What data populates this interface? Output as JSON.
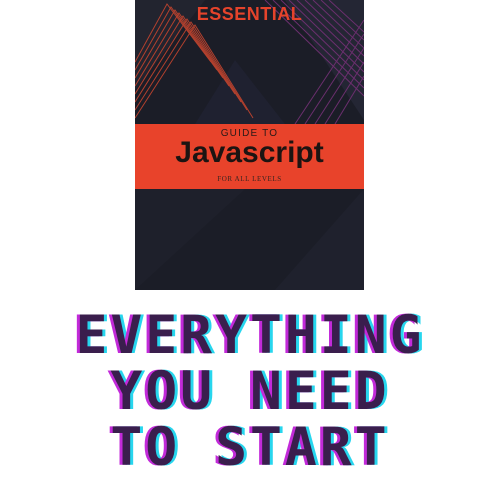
{
  "book_cover": {
    "title": "ESSENTIAL",
    "band_small": "GUIDE TO",
    "band_main": "Javascript",
    "band_footer": "FOR ALL LEVELS",
    "colors": {
      "background": "#1b1d27",
      "accent_red": "#e8432b",
      "line_orange": "#b4412e",
      "line_purple": "#6b2f6e"
    }
  },
  "tagline": {
    "lines": [
      "EVERYTHING",
      "YOU NEED",
      "TO START"
    ],
    "colors": {
      "fill": "#3a1e4d",
      "magenta": "#c22ad9",
      "cyan": "#27d6ee"
    }
  }
}
